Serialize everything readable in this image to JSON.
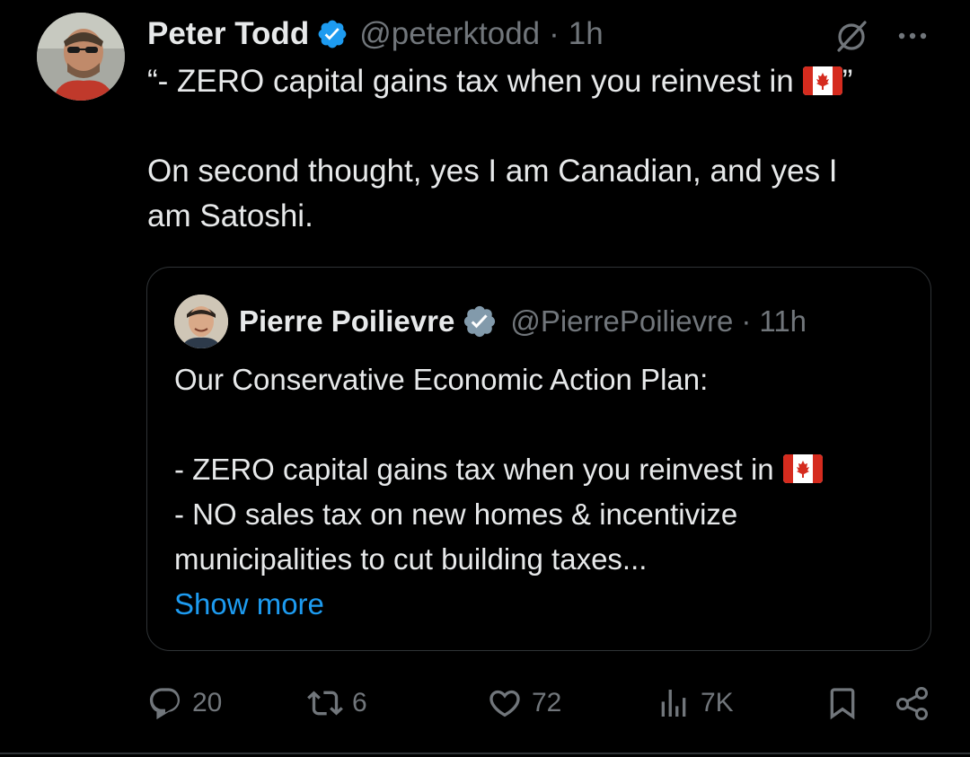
{
  "tweet": {
    "author": {
      "display_name": "Peter Todd",
      "handle": "@peterktodd",
      "separator": "·",
      "time": "1h",
      "verified": true
    },
    "text_lines": [
      "“- ZERO capital gains tax when you reinvest in",
      "”",
      "On second thought, yes I am Canadian, and yes I",
      "am Satoshi."
    ]
  },
  "quote": {
    "author": {
      "display_name": "Pierre Poilievre",
      "handle": "@PierrePoilievre",
      "separator": "·",
      "time": "11h",
      "verified": true,
      "verified_type": "government"
    },
    "lines": [
      "Our Conservative Economic Action Plan:",
      "- ZERO capital gains tax when you reinvest in",
      "- NO sales tax on new homes & incentivize",
      "municipalities to cut building taxes..."
    ],
    "show_more": "Show more"
  },
  "actions": {
    "replies": "20",
    "reposts": "6",
    "likes": "72",
    "views": "7K"
  },
  "icons": {
    "verified": "verified-badge-icon",
    "grok": "grok-icon",
    "more": "more-icon",
    "flag": "canada-flag-icon",
    "reply": "reply-icon",
    "repost": "repost-icon",
    "like": "like-icon",
    "views": "views-icon",
    "bookmark": "bookmark-icon",
    "share": "share-icon"
  },
  "colors": {
    "background": "#000000",
    "text_primary": "#e7e9ea",
    "text_secondary": "#71767b",
    "link": "#1d9bf0",
    "verified_blue": "#1d9bf0",
    "verified_gray": "#829aab",
    "border": "#2f3336"
  }
}
